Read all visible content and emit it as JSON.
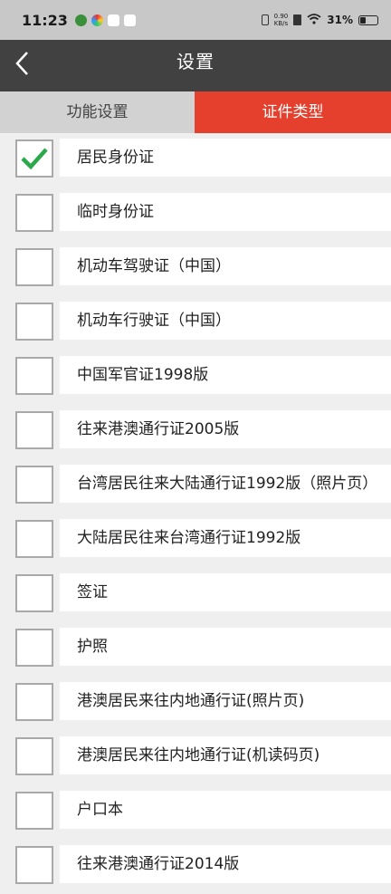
{
  "status_bar": {
    "time": "11:23",
    "net_speed_value": "0.90",
    "net_speed_unit": "KB/s",
    "battery": "31%"
  },
  "header": {
    "title": "设置"
  },
  "tabs": [
    {
      "label": "功能设置",
      "active": false
    },
    {
      "label": "证件类型",
      "active": true
    }
  ],
  "colors": {
    "header_bg": "#414141",
    "active_tab": "#e5402d",
    "check": "#2aa84a"
  },
  "id_types": [
    {
      "label": "居民身份证",
      "checked": true
    },
    {
      "label": "临时身份证",
      "checked": false
    },
    {
      "label": "机动车驾驶证（中国）",
      "checked": false
    },
    {
      "label": "机动车行驶证（中国）",
      "checked": false
    },
    {
      "label": "中国军官证1998版",
      "checked": false
    },
    {
      "label": "往来港澳通行证2005版",
      "checked": false
    },
    {
      "label": "台湾居民往来大陆通行证1992版（照片页）",
      "checked": false
    },
    {
      "label": "大陆居民往来台湾通行证1992版",
      "checked": false
    },
    {
      "label": "签证",
      "checked": false
    },
    {
      "label": "护照",
      "checked": false
    },
    {
      "label": "港澳居民来往内地通行证(照片页)",
      "checked": false
    },
    {
      "label": "港澳居民来往内地通行证(机读码页)",
      "checked": false
    },
    {
      "label": "户口本",
      "checked": false
    },
    {
      "label": "往来港澳通行证2014版",
      "checked": false
    }
  ]
}
